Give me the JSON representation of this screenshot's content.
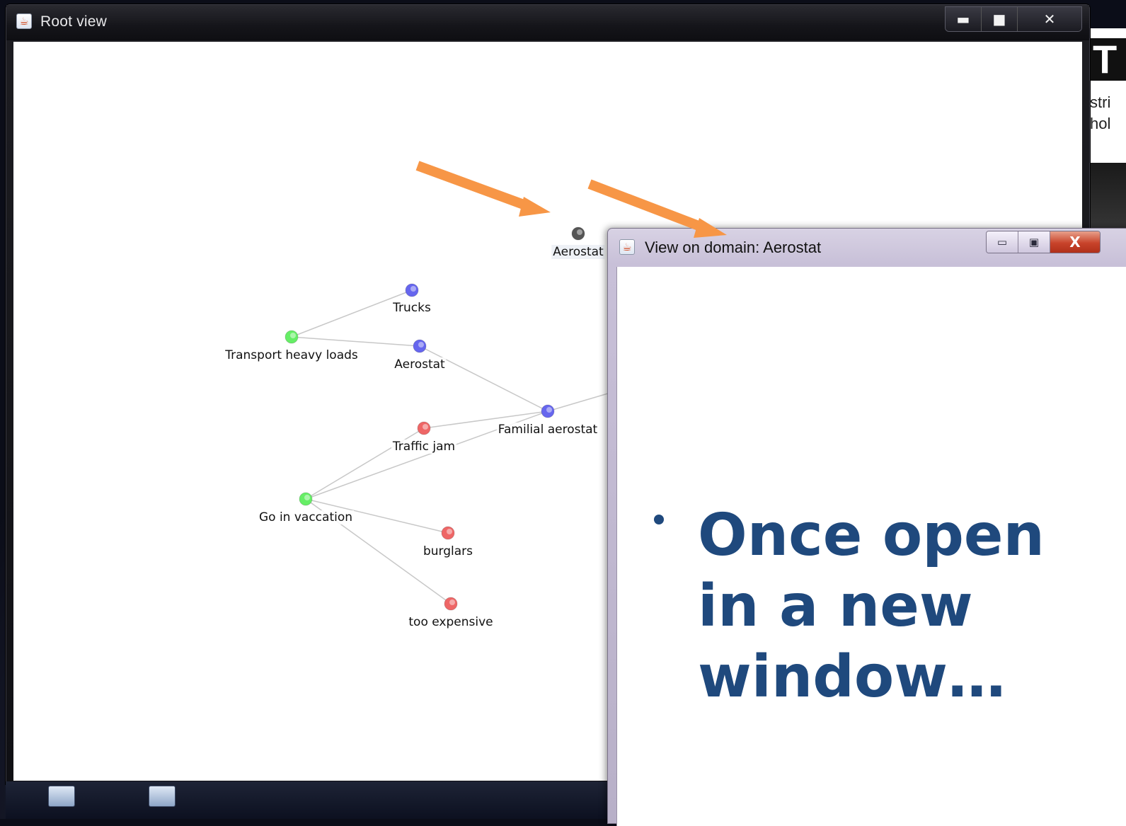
{
  "root_window": {
    "title": "Root view",
    "controls": {
      "minimize": "▬",
      "maximize": "■",
      "close": "✕"
    }
  },
  "graph": {
    "nodes": [
      {
        "id": "aerostat-top",
        "label": "Aerostat",
        "color": "#555555"
      },
      {
        "id": "trucks",
        "label": "Trucks",
        "color": "#6666ee"
      },
      {
        "id": "transport-heavy-loads",
        "label": "Transport heavy loads",
        "color": "#66ee66"
      },
      {
        "id": "aerostat",
        "label": "Aerostat",
        "color": "#6666ee"
      },
      {
        "id": "familial-aerostat",
        "label": "Familial aerostat",
        "color": "#6666ee"
      },
      {
        "id": "traffic-jam",
        "label": "Traffic jam",
        "color": "#ee6666"
      },
      {
        "id": "go-in-vaccation",
        "label": "Go in vaccation",
        "color": "#66ee66"
      },
      {
        "id": "burglars",
        "label": "burglars",
        "color": "#ee6666"
      },
      {
        "id": "too-expensive",
        "label": "too expensive",
        "color": "#ee6666"
      }
    ],
    "edges": [
      [
        "transport-heavy-loads",
        "trucks"
      ],
      [
        "transport-heavy-loads",
        "aerostat"
      ],
      [
        "aerostat",
        "familial-aerostat"
      ],
      [
        "traffic-jam",
        "familial-aerostat"
      ],
      [
        "go-in-vaccation",
        "traffic-jam"
      ],
      [
        "go-in-vaccation",
        "familial-aerostat"
      ],
      [
        "go-in-vaccation",
        "burglars"
      ],
      [
        "go-in-vaccation",
        "too-expensive"
      ]
    ],
    "colors": {
      "problem": "#ee6666",
      "solution": "#6666ee",
      "goal": "#66ee66",
      "domain": "#555555",
      "edge": "#c8c8c8"
    }
  },
  "domain_window": {
    "title": "View on domain: Aerostat",
    "controls": {
      "minimize": "▭",
      "maximize": "▣",
      "close": "X"
    }
  },
  "slide": {
    "bullet": "Once open\nin a new\nwindow…",
    "text_color": "#1f497d"
  },
  "arrows": {
    "color": "#f79646"
  }
}
